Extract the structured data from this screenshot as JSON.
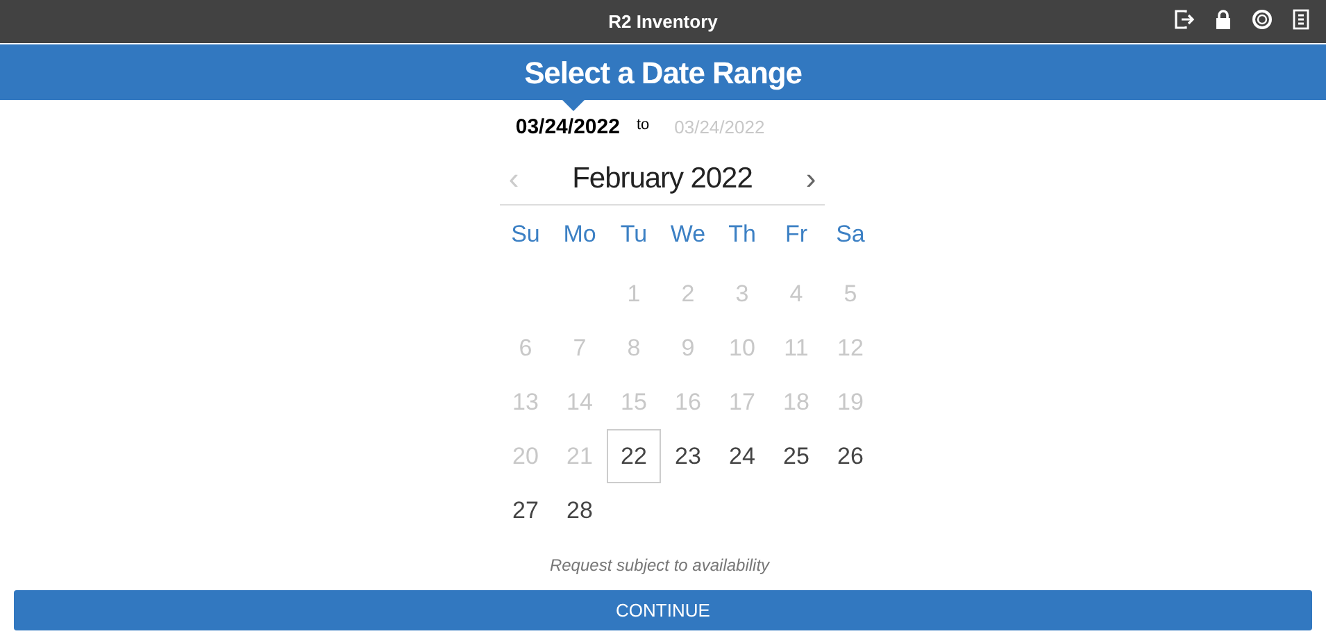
{
  "window": {
    "title": "R2 Inventory"
  },
  "header": {
    "title": "Select a Date Range"
  },
  "range": {
    "start": "03/24/2022",
    "separator": "to",
    "end_placeholder": "03/24/2022"
  },
  "calendar": {
    "month": "February 2022",
    "prev": {
      "label": "‹",
      "disabled": true
    },
    "next": {
      "label": "›",
      "disabled": false
    },
    "weekdays": [
      "Su",
      "Mo",
      "Tu",
      "We",
      "Th",
      "Fr",
      "Sa"
    ],
    "days": [
      {
        "label": "1",
        "disabled": true,
        "today": false
      },
      {
        "label": "2",
        "disabled": true,
        "today": false
      },
      {
        "label": "3",
        "disabled": true,
        "today": false
      },
      {
        "label": "4",
        "disabled": true,
        "today": false
      },
      {
        "label": "5",
        "disabled": true,
        "today": false
      },
      {
        "label": "6",
        "disabled": true,
        "today": false
      },
      {
        "label": "7",
        "disabled": true,
        "today": false
      },
      {
        "label": "8",
        "disabled": true,
        "today": false
      },
      {
        "label": "9",
        "disabled": true,
        "today": false
      },
      {
        "label": "10",
        "disabled": true,
        "today": false
      },
      {
        "label": "11",
        "disabled": true,
        "today": false
      },
      {
        "label": "12",
        "disabled": true,
        "today": false
      },
      {
        "label": "13",
        "disabled": true,
        "today": false
      },
      {
        "label": "14",
        "disabled": true,
        "today": false
      },
      {
        "label": "15",
        "disabled": true,
        "today": false
      },
      {
        "label": "16",
        "disabled": true,
        "today": false
      },
      {
        "label": "17",
        "disabled": true,
        "today": false
      },
      {
        "label": "18",
        "disabled": true,
        "today": false
      },
      {
        "label": "19",
        "disabled": true,
        "today": false
      },
      {
        "label": "20",
        "disabled": true,
        "today": false
      },
      {
        "label": "21",
        "disabled": true,
        "today": false
      },
      {
        "label": "22",
        "disabled": false,
        "today": true
      },
      {
        "label": "23",
        "disabled": false,
        "today": false
      },
      {
        "label": "24",
        "disabled": false,
        "today": false
      },
      {
        "label": "25",
        "disabled": false,
        "today": false
      },
      {
        "label": "26",
        "disabled": false,
        "today": false
      },
      {
        "label": "27",
        "disabled": false,
        "today": false
      },
      {
        "label": "28",
        "disabled": false,
        "today": false
      }
    ]
  },
  "note": "Request subject to availability",
  "button": "CONTINUE"
}
